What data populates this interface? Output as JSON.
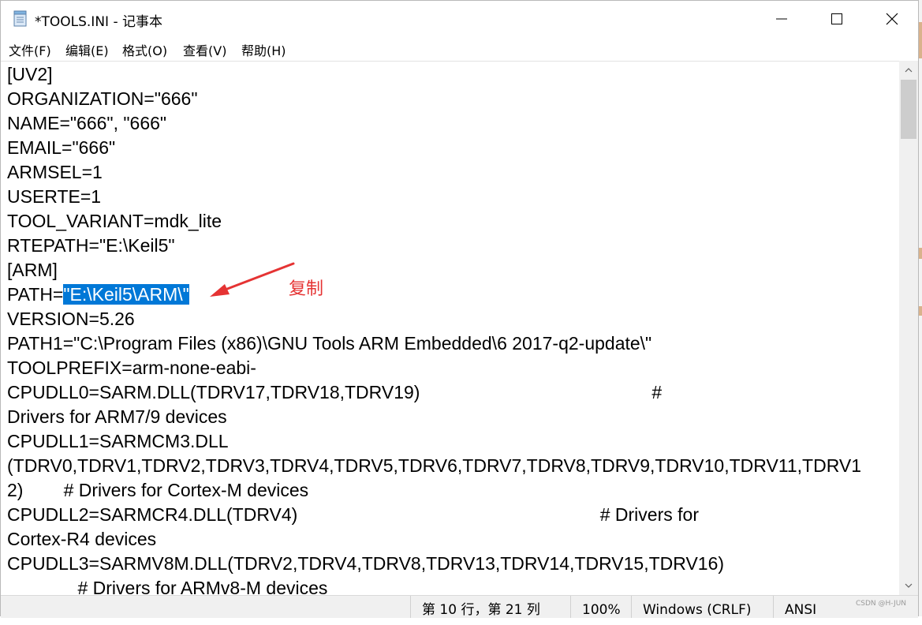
{
  "window": {
    "title": "*TOOLS.INI - 记事本",
    "controls": {
      "minimize_icon": "minimize-icon",
      "maximize_icon": "maximize-icon",
      "close_icon": "close-icon"
    }
  },
  "menu": {
    "items": [
      "文件(F)",
      "编辑(E)",
      "格式(O)",
      "查看(V)",
      "帮助(H)"
    ]
  },
  "editor": {
    "lines": [
      "[UV2]",
      "ORGANIZATION=\"666\"",
      "NAME=\"666\", \"666\"",
      "EMAIL=\"666\"",
      "ARMSEL=1",
      "USERTE=1",
      "TOOL_VARIANT=mdk_lite",
      "RTEPATH=\"E:\\Keil5\"",
      "[ARM]",
      "PATH=",
      "VERSION=5.26",
      "PATH1=\"C:\\Program Files (x86)\\GNU Tools ARM Embedded\\6 2017-q2-update\\\"",
      "TOOLPREFIX=arm-none-eabi-",
      "CPUDLL0=SARM.DLL(TDRV17,TDRV18,TDRV19)                                              #",
      "Drivers for ARM7/9 devices",
      "CPUDLL1=SARMCM3.DLL",
      "(TDRV0,TDRV1,TDRV2,TDRV3,TDRV4,TDRV5,TDRV6,TDRV7,TDRV8,TDRV9,TDRV10,TDRV11,TDRV1",
      "2)        # Drivers for Cortex-M devices",
      "CPUDLL2=SARMCR4.DLL(TDRV4)                                                            # Drivers for",
      "Cortex-R4 devices",
      "CPUDLL3=SARMV8M.DLL(TDRV2,TDRV4,TDRV8,TDRV13,TDRV14,TDRV15,TDRV16)",
      "              # Drivers for ARMv8-M devices"
    ],
    "selected_text": "\"E:\\Keil5\\ARM\\\"",
    "selection_color": "#0078d7"
  },
  "annotation": {
    "label": "复制",
    "color": "#e53333"
  },
  "statusbar": {
    "position": "第 10 行，第 21 列",
    "zoom": "100%",
    "line_ending": "Windows (CRLF)",
    "encoding": "ANSI"
  },
  "watermark": "CSDN @H-JUN"
}
